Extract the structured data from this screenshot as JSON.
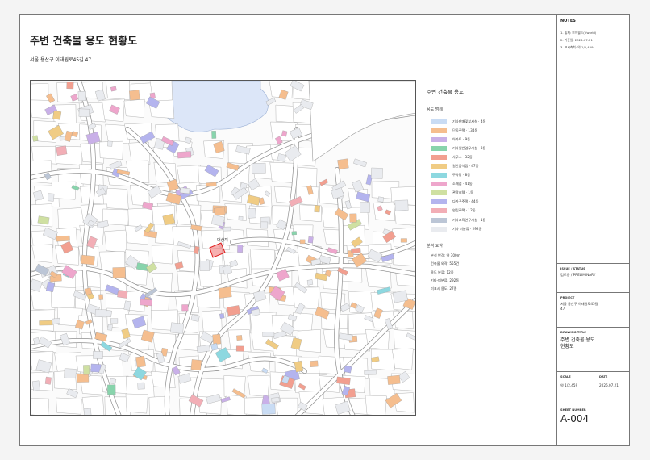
{
  "title": "주변 건축물 용도 현황도",
  "address": "서울 용산구 이태원로45길 47",
  "map": {
    "target_label": "대상지",
    "colors": {
      "water": "#dce6f8",
      "block_fill": "#ffffff",
      "block_stroke": "#b5b5b5",
      "road": "#ffffff",
      "road_edge": "#8f8f8f",
      "target_stroke": "#e02020"
    }
  },
  "legend": {
    "title": "주변 건축물 용도",
    "category_heading": "용도 범례",
    "items": [
      {
        "label": "기타판매및부시설 · 4동",
        "color": "#c9dcf4"
      },
      {
        "label": "단독주택 · 134동",
        "color": "#f5be8f"
      },
      {
        "label": "아파트 · 9동",
        "color": "#c9b0e8"
      },
      {
        "label": "기타일반업무시설 · 3동",
        "color": "#88d4ac"
      },
      {
        "label": "사무소 · 32동",
        "color": "#f29f90"
      },
      {
        "label": "일반음식점 · 47동",
        "color": "#f0cc84"
      },
      {
        "label": "주차장 · 8동",
        "color": "#8dd8e0"
      },
      {
        "label": "소매점 · 41동",
        "color": "#eea6cc"
      },
      {
        "label": "관광호텔 · 1동",
        "color": "#cfe0a2"
      },
      {
        "label": "다가구주택 · 44동",
        "color": "#b4b4ee"
      },
      {
        "label": "연립주택 · 12동",
        "color": "#f2aeb6"
      },
      {
        "label": "기타교육연구시설 · 1동",
        "color": "#bcc6d6"
      },
      {
        "label": "기타 미분류 · 292동",
        "color": "#e9ebef"
      }
    ]
  },
  "summary": {
    "heading": "분석 요약",
    "rows": [
      "분석 반경: 약 300m",
      "건축물 외곽: 555건",
      "용도 분류: 12종",
      "기타·미분류: 292동",
      "미표시 용도: 27종"
    ]
  },
  "title_block": {
    "notes_heading": "NOTES",
    "notes": [
      "1. 출처: 브이월드(Vworld)",
      "2. 기준일: 2026-07-21",
      "3. 표시축척: 약 1/2,459"
    ],
    "issue_head": "ISSUE / STATUS",
    "issue_value": "검토용 / PRELIMINARY",
    "project_head": "PROJECT",
    "project_lines": [
      "서울 용산구 이태원로45길",
      "47"
    ],
    "drawing_head": "DRAWING TITLE",
    "drawing_lines": [
      "주변 건축물 용도",
      "현황도"
    ],
    "scale_head": "SCALE",
    "scale_value": "약 1/2,459",
    "date_head": "DATE",
    "date_value": "2026.07.21",
    "sheet_head": "SHEET NUMBER",
    "sheet_number": "A-004"
  }
}
